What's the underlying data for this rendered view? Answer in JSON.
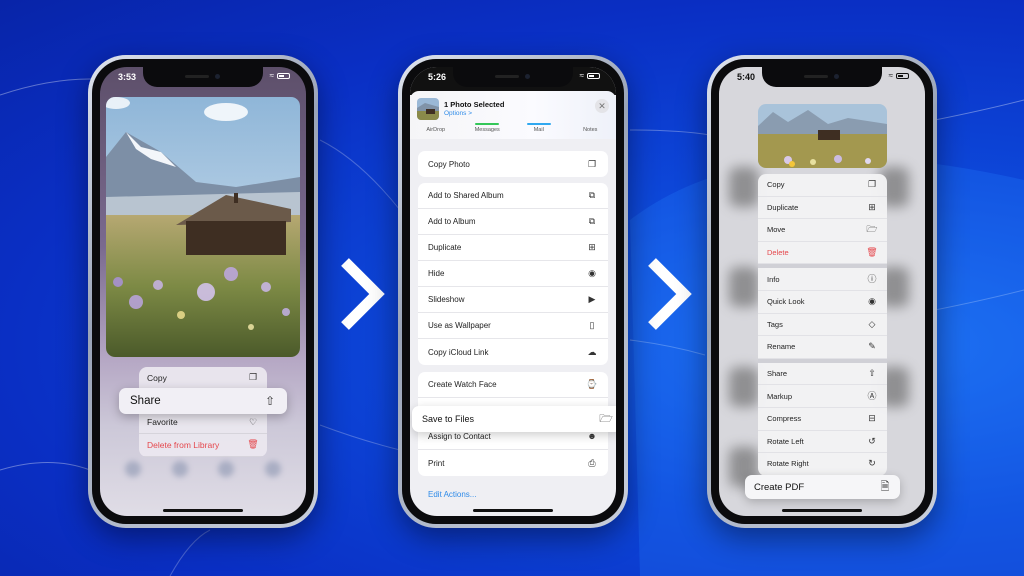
{
  "colors": {
    "background": "#0a2fc4",
    "accent_blue": "#2f8be8",
    "danger_red": "#e5484d",
    "messages_green": "#34c759",
    "mail_blue": "#30a8f0"
  },
  "phone1": {
    "status": {
      "time": "3:53"
    },
    "menu": {
      "items": [
        {
          "label": "Copy",
          "icon": "copy-icon"
        },
        {
          "label": "Share",
          "icon": "share-icon",
          "highlighted": true
        },
        {
          "label": "Favorite",
          "icon": "heart-icon"
        },
        {
          "label": "Delete from Library",
          "icon": "trash-icon",
          "destructive": true
        }
      ]
    }
  },
  "phone2": {
    "status": {
      "time": "5:26"
    },
    "sheet": {
      "title": "1 Photo Selected",
      "options": "Options >",
      "apps": [
        "AirDrop",
        "Messages",
        "Mail",
        "Notes"
      ],
      "groups": [
        [
          {
            "label": "Copy Photo",
            "icon": "copy-icon"
          }
        ],
        [
          {
            "label": "Add to Shared Album",
            "icon": "shared-album-icon"
          },
          {
            "label": "Add to Album",
            "icon": "album-icon"
          },
          {
            "label": "Duplicate",
            "icon": "duplicate-icon"
          },
          {
            "label": "Hide",
            "icon": "eye-slash-icon"
          },
          {
            "label": "Slideshow",
            "icon": "play-icon"
          },
          {
            "label": "Use as Wallpaper",
            "icon": "phone-icon"
          },
          {
            "label": "Copy iCloud Link",
            "icon": "cloud-link-icon"
          }
        ],
        [
          {
            "label": "Create Watch Face",
            "icon": "watch-icon"
          },
          {
            "label": "Save to Files",
            "icon": "folder-icon",
            "highlighted": true
          },
          {
            "label": "Assign to Contact",
            "icon": "contact-icon"
          },
          {
            "label": "Print",
            "icon": "printer-icon"
          }
        ]
      ],
      "edit_actions": "Edit Actions..."
    }
  },
  "phone3": {
    "status": {
      "time": "5:40"
    },
    "menu": {
      "sections": [
        [
          {
            "label": "Copy",
            "icon": "copy-icon"
          },
          {
            "label": "Duplicate",
            "icon": "duplicate-icon"
          },
          {
            "label": "Move",
            "icon": "folder-icon"
          },
          {
            "label": "Delete",
            "icon": "trash-icon",
            "destructive": true
          }
        ],
        [
          {
            "label": "Info",
            "icon": "info-icon"
          },
          {
            "label": "Quick Look",
            "icon": "eye-icon"
          },
          {
            "label": "Tags",
            "icon": "tag-icon"
          },
          {
            "label": "Rename",
            "icon": "pencil-icon"
          }
        ],
        [
          {
            "label": "Share",
            "icon": "share-icon"
          },
          {
            "label": "Markup",
            "icon": "markup-icon"
          },
          {
            "label": "Compress",
            "icon": "archive-icon"
          },
          {
            "label": "Rotate Left",
            "icon": "rotate-left-icon"
          },
          {
            "label": "Rotate Right",
            "icon": "rotate-right-icon"
          }
        ]
      ],
      "create_pdf": {
        "label": "Create PDF",
        "icon": "document-icon"
      }
    }
  }
}
